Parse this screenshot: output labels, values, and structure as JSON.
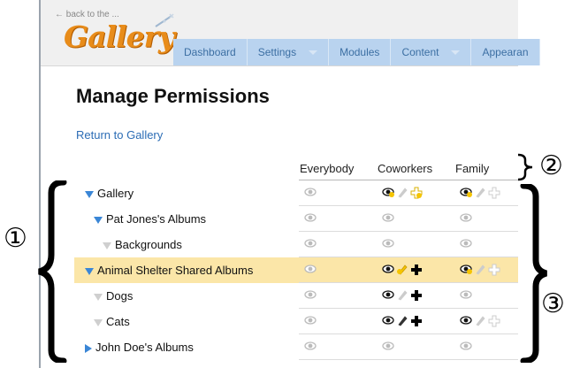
{
  "header": {
    "back_link": "← back to the ...",
    "logo": "Gallery",
    "menu": [
      {
        "label": "Dashboard",
        "has_caret": false
      },
      {
        "label": "Settings",
        "has_caret": true
      },
      {
        "label": "Modules",
        "has_caret": false
      },
      {
        "label": "Content",
        "has_caret": true
      },
      {
        "label": "Appearan",
        "has_caret": false
      }
    ]
  },
  "page": {
    "title": "Manage Permissions",
    "return_link": "Return to Gallery"
  },
  "table": {
    "columns": [
      "Everybody",
      "Coworkers",
      "Family"
    ],
    "rows": [
      {
        "label": "Gallery",
        "toggle": "open",
        "indent": 0,
        "highlight": false,
        "perms": [
          [
            "view-faded"
          ],
          [
            "view-lit",
            "edit-faded",
            "add-lit"
          ],
          [
            "view-lit",
            "edit-faded",
            "add-faded"
          ]
        ]
      },
      {
        "label": "Pat Jones's Albums",
        "toggle": "open",
        "indent": 1,
        "highlight": false,
        "perms": [
          [
            "view-faded"
          ],
          [
            "view-faded"
          ],
          [
            "view-faded"
          ]
        ]
      },
      {
        "label": "Backgrounds",
        "toggle": "open-light",
        "indent": 2,
        "highlight": false,
        "perms": [
          [
            "view-faded"
          ],
          [
            "view-faded"
          ],
          [
            "view-faded"
          ]
        ]
      },
      {
        "label": "Animal Shelter Shared Albums",
        "toggle": "open",
        "indent": 0,
        "highlight": true,
        "perms": [
          [
            "view-faded"
          ],
          [
            "view-dark",
            "edit-lit",
            "add-dark"
          ],
          [
            "view-lit",
            "edit-faded",
            "add-faded"
          ]
        ]
      },
      {
        "label": "Dogs",
        "toggle": "open-light",
        "indent": 1,
        "highlight": false,
        "perms": [
          [
            "view-faded"
          ],
          [
            "view-dark",
            "edit-faded",
            "add-dark"
          ],
          [
            "view-faded"
          ]
        ]
      },
      {
        "label": "Cats",
        "toggle": "open-light",
        "indent": 1,
        "highlight": false,
        "perms": [
          [
            "view-faded"
          ],
          [
            "view-dark",
            "edit-dark",
            "add-dark"
          ],
          [
            "view-dark",
            "edit-faded",
            "add-faded"
          ]
        ]
      },
      {
        "label": "John Doe's Albums",
        "toggle": "closed",
        "indent": 0,
        "highlight": false,
        "perms": [
          [
            "view-faded"
          ],
          [
            "view-faded"
          ],
          [
            "view-faded"
          ]
        ]
      }
    ]
  },
  "annotations": [
    "①",
    "②",
    "③"
  ],
  "colors": {
    "menu_bg": "#b9d3ef",
    "menu_text": "#3c6fa3",
    "link": "#2c6db5",
    "highlight": "#fbe6a8",
    "logo": "#e88c1a"
  }
}
